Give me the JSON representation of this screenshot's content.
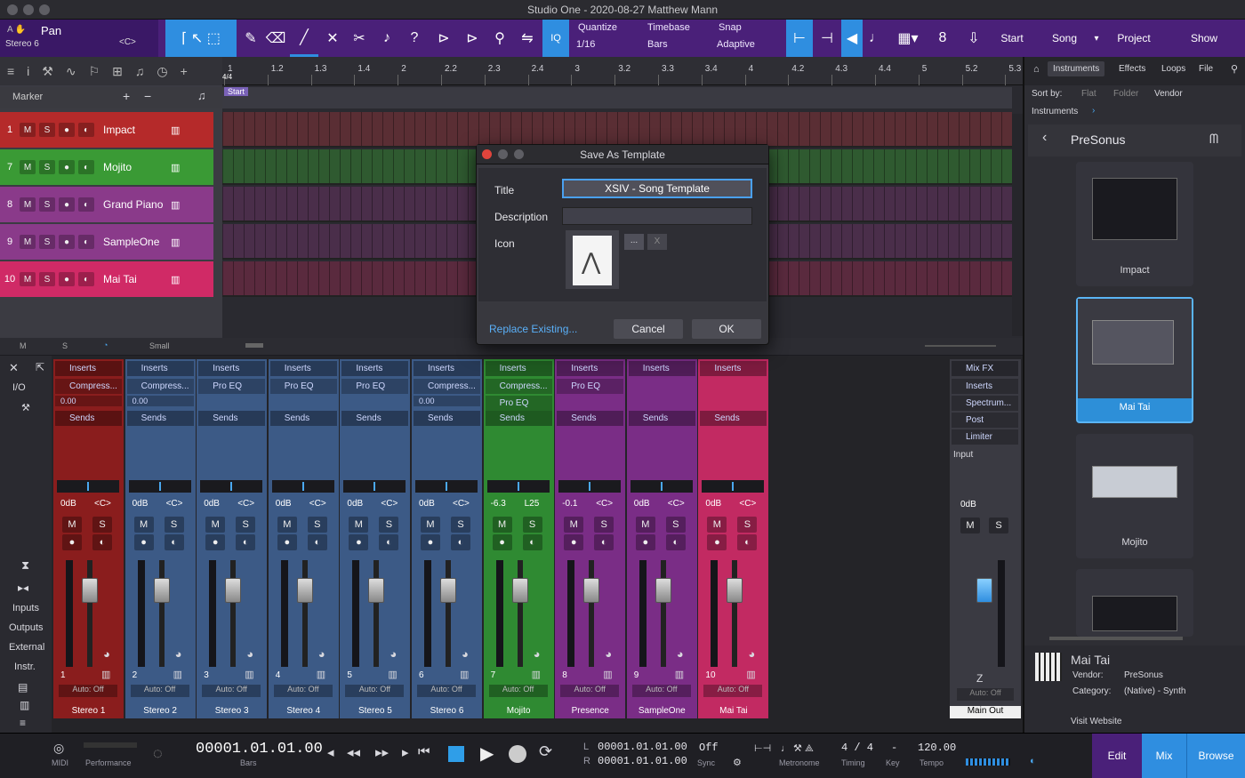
{
  "window": {
    "title": "Studio One - 2020-08-27 Matthew Mann"
  },
  "toolbar": {
    "channel_name": "Pan",
    "channel_sub": "Stereo 6",
    "channel_pan": "<C>",
    "quantize_label": "Quantize",
    "quantize_value": "1/16",
    "timebase_label": "Timebase",
    "timebase_value": "Bars",
    "snap_label": "Snap",
    "snap_value": "Adaptive",
    "iq": "IQ",
    "nav": [
      "Start",
      "Song",
      "Project",
      "Show"
    ]
  },
  "ruler": {
    "marks": [
      "1",
      "1.2",
      "1.3",
      "1.4",
      "2",
      "2.2",
      "2.3",
      "2.4",
      "3",
      "3.2",
      "3.3",
      "3.4",
      "4",
      "4.2",
      "4.3",
      "4.4",
      "5",
      "5.2",
      "5.3"
    ],
    "start_marker": "Start",
    "time_sig": "4/4"
  },
  "track_panel": {
    "marker_label": "Marker",
    "tracks": [
      {
        "num": "1",
        "name": "Impact",
        "color": "#b52a2a"
      },
      {
        "num": "7",
        "name": "Mojito",
        "color": "#3a9a35"
      },
      {
        "num": "8",
        "name": "Grand Piano",
        "color": "#8a3a8a"
      },
      {
        "num": "9",
        "name": "SampleOne",
        "color": "#8a3a8a"
      },
      {
        "num": "10",
        "name": "Mai Tai",
        "color": "#d02a66"
      }
    ],
    "mute": "M",
    "solo": "S",
    "footer": {
      "m": "M",
      "s": "S",
      "size": "Small"
    }
  },
  "dialog": {
    "title": "Save As Template",
    "title_label": "Title",
    "title_value": "XSIV - Song Template",
    "description_label": "Description",
    "description_value": "",
    "icon_label": "Icon",
    "icon_browse": "...",
    "icon_clear": "X",
    "replace": "Replace Existing...",
    "cancel": "Cancel",
    "ok": "OK"
  },
  "browser": {
    "tabs": [
      "Instruments",
      "Effects",
      "Loops",
      "File"
    ],
    "sort_by": "Sort by:",
    "sort_opts": [
      "Flat",
      "Folder",
      "Vendor"
    ],
    "breadcrumb": "Instruments",
    "vendor": "PreSonus",
    "cards": [
      "Impact",
      "Mai Tai",
      "Mojito"
    ],
    "info": {
      "name": "Mai Tai",
      "vendor_label": "Vendor:",
      "vendor": "PreSonus",
      "category_label": "Category:",
      "category": "(Native) - Synth",
      "website": "Visit Website"
    }
  },
  "mixer": {
    "left": [
      "I/O",
      "Inputs",
      "Outputs",
      "External",
      "Instr."
    ],
    "inserts": "Inserts",
    "sends": "Sends",
    "auto": "Auto: Off",
    "channels": [
      {
        "num": "1",
        "name": "Stereo 1",
        "vol": "0dB",
        "pan": "<C>",
        "plugin": "Compress...",
        "val": "0.00",
        "color": "#8a1d1d"
      },
      {
        "num": "2",
        "name": "Stereo 2",
        "vol": "0dB",
        "pan": "<C>",
        "plugin": "Compress...",
        "val": "0.00",
        "color": "#3c5a86"
      },
      {
        "num": "3",
        "name": "Stereo 3",
        "vol": "0dB",
        "pan": "<C>",
        "plugin": "Pro EQ",
        "val": "",
        "color": "#3c5a86"
      },
      {
        "num": "4",
        "name": "Stereo 4",
        "vol": "0dB",
        "pan": "<C>",
        "plugin": "Pro EQ",
        "val": "",
        "color": "#3c5a86"
      },
      {
        "num": "5",
        "name": "Stereo 5",
        "vol": "0dB",
        "pan": "<C>",
        "plugin": "Pro EQ",
        "val": "",
        "color": "#3c5a86"
      },
      {
        "num": "6",
        "name": "Stereo 6",
        "vol": "0dB",
        "pan": "<C>",
        "plugin": "Compress...",
        "val": "0.00",
        "color": "#3c5a86"
      },
      {
        "num": "7",
        "name": "Mojito",
        "vol": "-6.3",
        "pan": "L25",
        "plugin": "Compress...",
        "plugin2": "Pro EQ",
        "val": "",
        "color": "#2f8a32"
      },
      {
        "num": "8",
        "name": "Presence",
        "vol": "-0.1",
        "pan": "<C>",
        "plugin": "Pro EQ",
        "val": "",
        "color": "#7a2d86"
      },
      {
        "num": "9",
        "name": "SampleOne",
        "vol": "0dB",
        "pan": "<C>",
        "plugin": "",
        "val": "",
        "color": "#7a2d86"
      },
      {
        "num": "10",
        "name": "Mai Tai",
        "vol": "0dB",
        "pan": "<C>",
        "plugin": "",
        "val": "",
        "color": "#c22a62"
      }
    ],
    "main": {
      "name": "Main Out",
      "vol": "0dB",
      "mixfx": "Mix FX",
      "plugins": [
        "Inserts",
        "Spectrum...",
        "Post",
        "Limiter"
      ],
      "input": "Input"
    },
    "scale": [
      "10",
      "6",
      "0",
      "-6",
      "-12",
      "-18",
      "-24",
      "-36",
      "-48",
      "-72"
    ]
  },
  "transport": {
    "midi": "MIDI",
    "performance": "Performance",
    "position": "00001.01.01.00",
    "position_label": "Bars",
    "loop_l": "00001.01.01.00",
    "loop_r": "00001.01.01.00",
    "l": "L",
    "r": "R",
    "sync_val": "Off",
    "sync": "Sync",
    "metronome": "Metronome",
    "timing_val": "4 / 4",
    "timing": "Timing",
    "key_val": "-",
    "key": "Key",
    "tempo_val": "120.00",
    "tempo": "Tempo",
    "views": [
      "Edit",
      "Mix",
      "Browse"
    ]
  }
}
